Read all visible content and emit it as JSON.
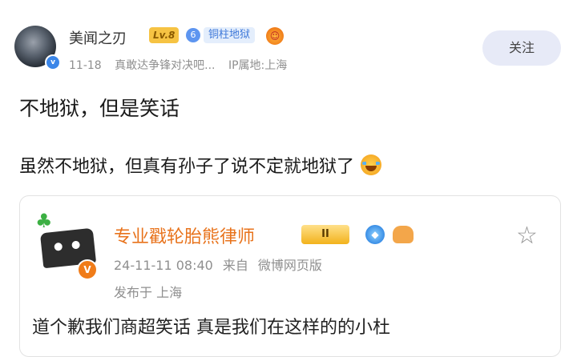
{
  "post": {
    "username": "美闻之刃",
    "level_badge": "Lv.8",
    "level_number": "6",
    "tag_badge": "铜柱地狱",
    "date": "11-18",
    "source": "真敢达争锋对决吧...",
    "location": "IP属地:上海",
    "follow_label": "关注",
    "line1": "不地狱，但是笑话",
    "line2": "虽然不地狱，但真有孙子了说不定就地狱了"
  },
  "quote": {
    "username": "专业戳轮胎熊律师",
    "crown_label": "II",
    "datetime": "24-11-11 08:40",
    "source_prefix": "来自",
    "source": "微博网页版",
    "published_at": "发布于 上海",
    "body_partial": "道个歉我们商超笑话 真是我们在这样的的小杜"
  },
  "icons": {
    "avatar_verified": "v-badge",
    "orange_v": "v-badge-orange",
    "favorite": "star-outline-icon",
    "laugh": "laugh-cry-emoji"
  },
  "colors": {
    "accent_orange": "#e8731c",
    "follow_bg": "#e7eaf7",
    "meta_gray": "#8f8f8f"
  }
}
